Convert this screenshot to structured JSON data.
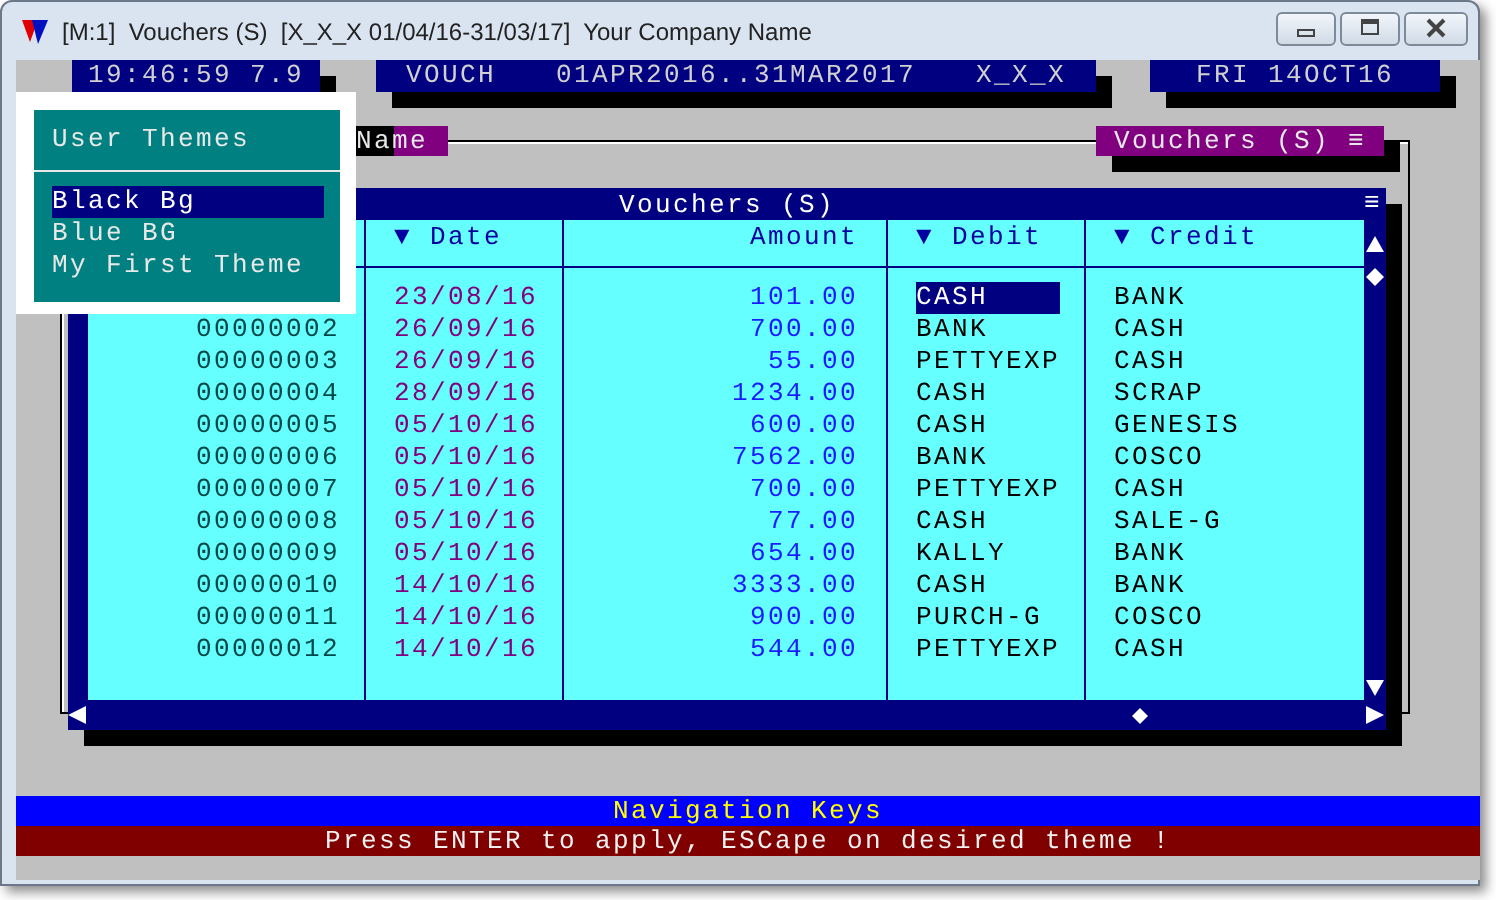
{
  "window": {
    "title": "[M:1]  Vouchers (S)  [X_X_X 01/04/16-31/03/17]  Your Company Name"
  },
  "top_bar": {
    "clock": "19:46:59 7.9",
    "module": "VOUCH",
    "period": "01APR2016..31MAR2017",
    "company_code": "X_X_X",
    "date": "FRI 14OCT16"
  },
  "field_tab": "Name",
  "list_tab": "Vouchers (S) ≡",
  "table": {
    "title": "Vouchers (S)",
    "menu_glyph": "≡",
    "columns": [
      "▼ Date",
      "Amount",
      "▼ Debit",
      "▼ Credit"
    ],
    "rows": [
      {
        "date": "23/08/16",
        "amount": "101.00",
        "debit": "CASH",
        "credit": "BANK",
        "selected": true
      },
      {
        "number": "00000002",
        "date": "26/09/16",
        "amount": "700.00",
        "debit": "BANK",
        "credit": "CASH",
        "selected": false
      },
      {
        "number": "00000003",
        "date": "26/09/16",
        "amount": "55.00",
        "debit": "PETTYEXP",
        "credit": "CASH",
        "selected": false
      },
      {
        "number": "00000004",
        "date": "28/09/16",
        "amount": "1234.00",
        "debit": "CASH",
        "credit": "SCRAP",
        "selected": false
      },
      {
        "number": "00000005",
        "date": "05/10/16",
        "amount": "600.00",
        "debit": "CASH",
        "credit": "GENESIS",
        "selected": false
      },
      {
        "number": "00000006",
        "date": "05/10/16",
        "amount": "7562.00",
        "debit": "BANK",
        "credit": "COSCO",
        "selected": false
      },
      {
        "number": "00000007",
        "date": "05/10/16",
        "amount": "700.00",
        "debit": "PETTYEXP",
        "credit": "CASH",
        "selected": false
      },
      {
        "number": "00000008",
        "date": "05/10/16",
        "amount": "77.00",
        "debit": "CASH",
        "credit": "SALE-G",
        "selected": false
      },
      {
        "number": "00000009",
        "date": "05/10/16",
        "amount": "654.00",
        "debit": "KALLY",
        "credit": "BANK",
        "selected": false
      },
      {
        "number": "00000010",
        "date": "14/10/16",
        "amount": "3333.00",
        "debit": "CASH",
        "credit": "BANK",
        "selected": false
      },
      {
        "number": "00000011",
        "date": "14/10/16",
        "amount": "900.00",
        "debit": "PURCH-G",
        "credit": "COSCO",
        "selected": false
      },
      {
        "number": "00000012",
        "date": "14/10/16",
        "amount": "544.00",
        "debit": "PETTYEXP",
        "credit": "CASH",
        "selected": false
      }
    ]
  },
  "theme_menu": {
    "title": "User Themes",
    "items": [
      {
        "label": "Black Bg",
        "selected": true
      },
      {
        "label": "Blue BG",
        "selected": false
      },
      {
        "label": "My First Theme",
        "selected": false
      }
    ]
  },
  "help_bar": "Navigation Keys",
  "message_bar": "Press ENTER to apply, ESCape on desired theme !"
}
